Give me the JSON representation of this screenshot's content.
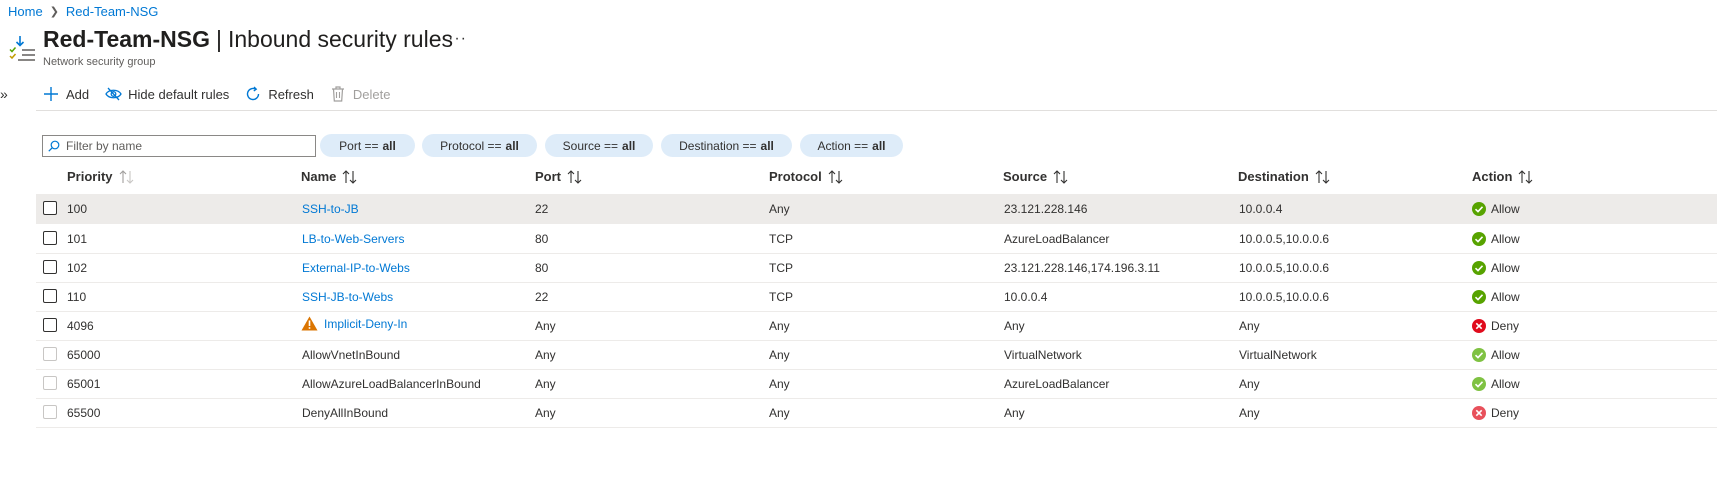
{
  "breadcrumb": {
    "home": "Home",
    "current": "Red-Team-NSG"
  },
  "header": {
    "resource": "Red-Team-NSG",
    "page": "Inbound security rules",
    "separator": "|",
    "subtitle": "Network security group",
    "more": "···"
  },
  "toolbar": {
    "add": "Add",
    "hide_default": "Hide default rules",
    "refresh": "Refresh",
    "delete": "Delete"
  },
  "filters": {
    "search_placeholder": "Filter by name",
    "pills": [
      {
        "label": "Port ==",
        "value": "all"
      },
      {
        "label": "Protocol ==",
        "value": "all"
      },
      {
        "label": "Source ==",
        "value": "all"
      },
      {
        "label": "Destination ==",
        "value": "all"
      },
      {
        "label": "Action ==",
        "value": "all"
      }
    ]
  },
  "table": {
    "columns": [
      "Priority",
      "Name",
      "Port",
      "Protocol",
      "Source",
      "Destination",
      "Action"
    ],
    "rows": [
      {
        "priority": "100",
        "name": "SSH-to-JB",
        "port": "22",
        "protocol": "Any",
        "source": "23.121.228.146",
        "destination": "10.0.0.4",
        "action": "Allow"
      },
      {
        "priority": "101",
        "name": "LB-to-Web-Servers",
        "port": "80",
        "protocol": "TCP",
        "source": "AzureLoadBalancer",
        "destination": "10.0.0.5,10.0.0.6",
        "action": "Allow"
      },
      {
        "priority": "102",
        "name": "External-IP-to-Webs",
        "port": "80",
        "protocol": "TCP",
        "source": "23.121.228.146,174.196.3.11",
        "destination": "10.0.0.5,10.0.0.6",
        "action": "Allow"
      },
      {
        "priority": "110",
        "name": "SSH-JB-to-Webs",
        "port": "22",
        "protocol": "TCP",
        "source": "10.0.0.4",
        "destination": "10.0.0.5,10.0.0.6",
        "action": "Allow"
      },
      {
        "priority": "4096",
        "name": "Implicit-Deny-In",
        "port": "Any",
        "protocol": "Any",
        "source": "Any",
        "destination": "Any",
        "action": "Deny"
      },
      {
        "priority": "65000",
        "name": "AllowVnetInBound",
        "port": "Any",
        "protocol": "Any",
        "source": "VirtualNetwork",
        "destination": "VirtualNetwork",
        "action": "Allow"
      },
      {
        "priority": "65001",
        "name": "AllowAzureLoadBalancerInBound",
        "port": "Any",
        "protocol": "Any",
        "source": "AzureLoadBalancer",
        "destination": "Any",
        "action": "Allow"
      },
      {
        "priority": "65500",
        "name": "DenyAllInBound",
        "port": "Any",
        "protocol": "Any",
        "source": "Any",
        "destination": "Any",
        "action": "Deny"
      }
    ]
  },
  "colors": {
    "accent": "#0078d4",
    "pill_bg": "#deecf9",
    "allow": "#57a300",
    "deny": "#e00b1c",
    "warning": "#db7500",
    "selected_row": "#edebe9"
  }
}
